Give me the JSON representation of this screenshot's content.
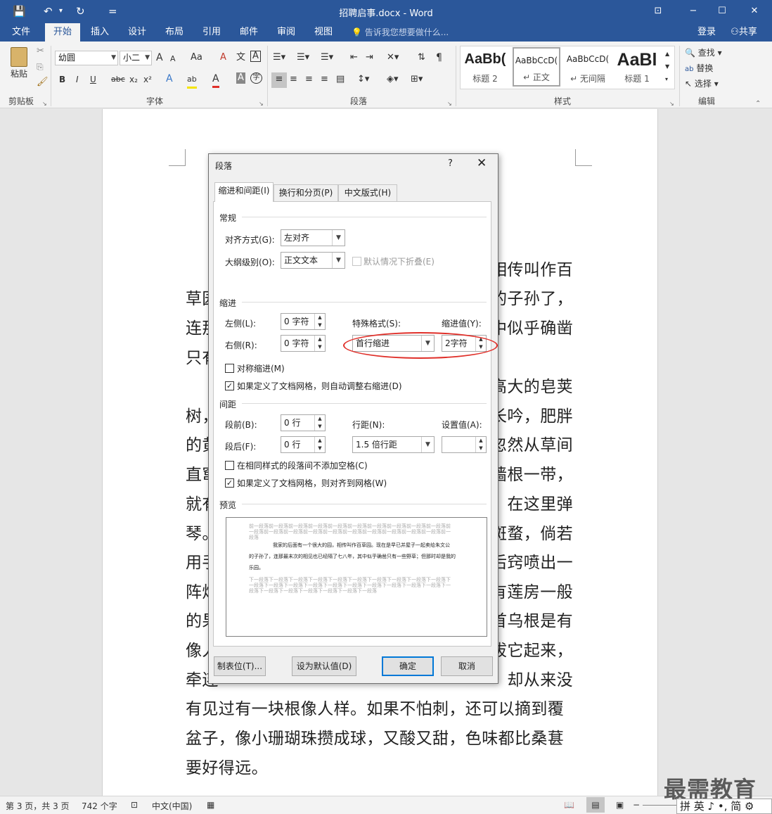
{
  "window": {
    "title": "招聘启事.docx - Word",
    "help_icon": "⊡",
    "min": "−",
    "max": "☐",
    "close": "✕"
  },
  "qat": {
    "save": "💾",
    "undo": "↶",
    "undo_arrow": "▾",
    "redo": "↻",
    "customize": "="
  },
  "tabs": [
    "文件",
    "开始",
    "插入",
    "设计",
    "布局",
    "引用",
    "邮件",
    "审阅",
    "视图"
  ],
  "tell_me": "告诉我您想要做什么...",
  "login": "登录",
  "share": "共享",
  "ribbon": {
    "clipboard": {
      "paste": "粘贴",
      "label": "剪贴板"
    },
    "font": {
      "name": "幼圆",
      "size": "小二",
      "label": "字体",
      "bold": "B",
      "italic": "I",
      "underline": "U",
      "strike": "abc",
      "sub": "x₂",
      "sup": "x²",
      "grow": "A",
      "shrink": "A",
      "case": "Aa",
      "clear": "A",
      "phonetic": "文",
      "border_char": "A",
      "effect": "A",
      "highlight": "ab",
      "color": "A",
      "shade": "A",
      "enclose": "字"
    },
    "paragraph": {
      "label": "段落"
    },
    "styles": {
      "label": "样式",
      "items": [
        {
          "preview": "AaBb(",
          "name": "标题 2"
        },
        {
          "preview": "AaBbCcD(",
          "name": "↵ 正文"
        },
        {
          "preview": "AaBbCcD(",
          "name": "↵ 无间隔"
        },
        {
          "preview": "AaBl",
          "name": "标题 1"
        }
      ]
    },
    "editing": {
      "label": "编辑",
      "find": "查找",
      "replace": "替换",
      "select": "选择"
    }
  },
  "doc_lines_left": [
    "草园",
    "连那",
    "只有",
    "树，",
    "的黄",
    "直窜",
    "就有",
    "琴。",
    "用手",
    "阵烟",
    "的果",
    "像人",
    "牵连"
  ],
  "doc_lines_right": [
    "相传叫作百",
    "的子孙了，",
    "中似乎确凿",
    "高大的皂荚",
    "长吟，肥胖",
    "忽然从草间",
    "墙根一带，",
    "在这里弹",
    "斑蝥，倘若",
    "后窍喷出一",
    "有莲房一般",
    "首乌根是有",
    "拔它起来，",
    "却从来没"
  ],
  "doc_full_lines": [
    "有见过有一块根像人样。如果不怕刺，还可以摘到覆",
    "盆子，像小珊瑚珠攒成球，又酸又甜，色味都比桑葚",
    "要好得远。"
  ],
  "dialog": {
    "title": "段落",
    "help": "?",
    "close": "✕",
    "tabs": [
      "缩进和间距(I)",
      "换行和分页(P)",
      "中文版式(H)"
    ],
    "general": {
      "header": "常规",
      "alignment_label": "对齐方式(G):",
      "alignment": "左对齐",
      "outline_label": "大纲级别(O):",
      "outline": "正文文本",
      "collapse": "默认情况下折叠(E)"
    },
    "indent": {
      "header": "缩进",
      "left_label": "左侧(L):",
      "left": "0 字符",
      "right_label": "右侧(R):",
      "right": "0 字符",
      "special_label": "特殊格式(S):",
      "special": "首行缩进",
      "by_label": "缩进值(Y):",
      "by": "2字符",
      "mirror": "对称缩进(M)",
      "auto_adjust": "如果定义了文档网格，则自动调整右缩进(D)"
    },
    "spacing": {
      "header": "间距",
      "before_label": "段前(B):",
      "before": "0 行",
      "after_label": "段后(F):",
      "after": "0 行",
      "line_label": "行距(N):",
      "line": "1.5 倍行距",
      "at_label": "设置值(A):",
      "at": "",
      "no_space": "在相同样式的段落间不添加空格(C)",
      "snap": "如果定义了文档网格，则对齐到网格(W)"
    },
    "preview": {
      "header": "预览",
      "prev": "前一段落前一段落前一段落前一段落前一段落前一段落前一段落前一段落前一段落前一段落前一段落前一段落前一段落前一段落前一段落前一段落前一段落前一段落前一段落前一段落前一段落",
      "text1": "我家的后面有一个很大的园，相传叫作百草园。现在是早已并屋子一起卖给朱文公",
      "text2": "的子孙了，连那最末次的相见也已经隔了七八年，其中似乎确凿只有一些野草；但那时却是我的",
      "text3": "乐园。",
      "next": "下一段落下一段落下一段落下一段落下一段落下一段落下一段落下一段落下一段落下一段落下一段落下一段落下一段落下一段落下一段落下一段落下一段落下一段落下一段落下一段落下一段落下一段落下一段落下一段落下一段落下一段落下一段落"
    },
    "buttons": {
      "tabs": "制表位(T)...",
      "default": "设为默认值(D)",
      "ok": "确定",
      "cancel": "取消"
    }
  },
  "status": {
    "page": "第 3 页，共 3 页",
    "words": "742 个字",
    "lang": "中文(中国)",
    "zoom_minus": "−",
    "zoom_plus": "+"
  },
  "ime": "拼 英 ♪ •, 简 ⚙",
  "watermark": "最需教育"
}
